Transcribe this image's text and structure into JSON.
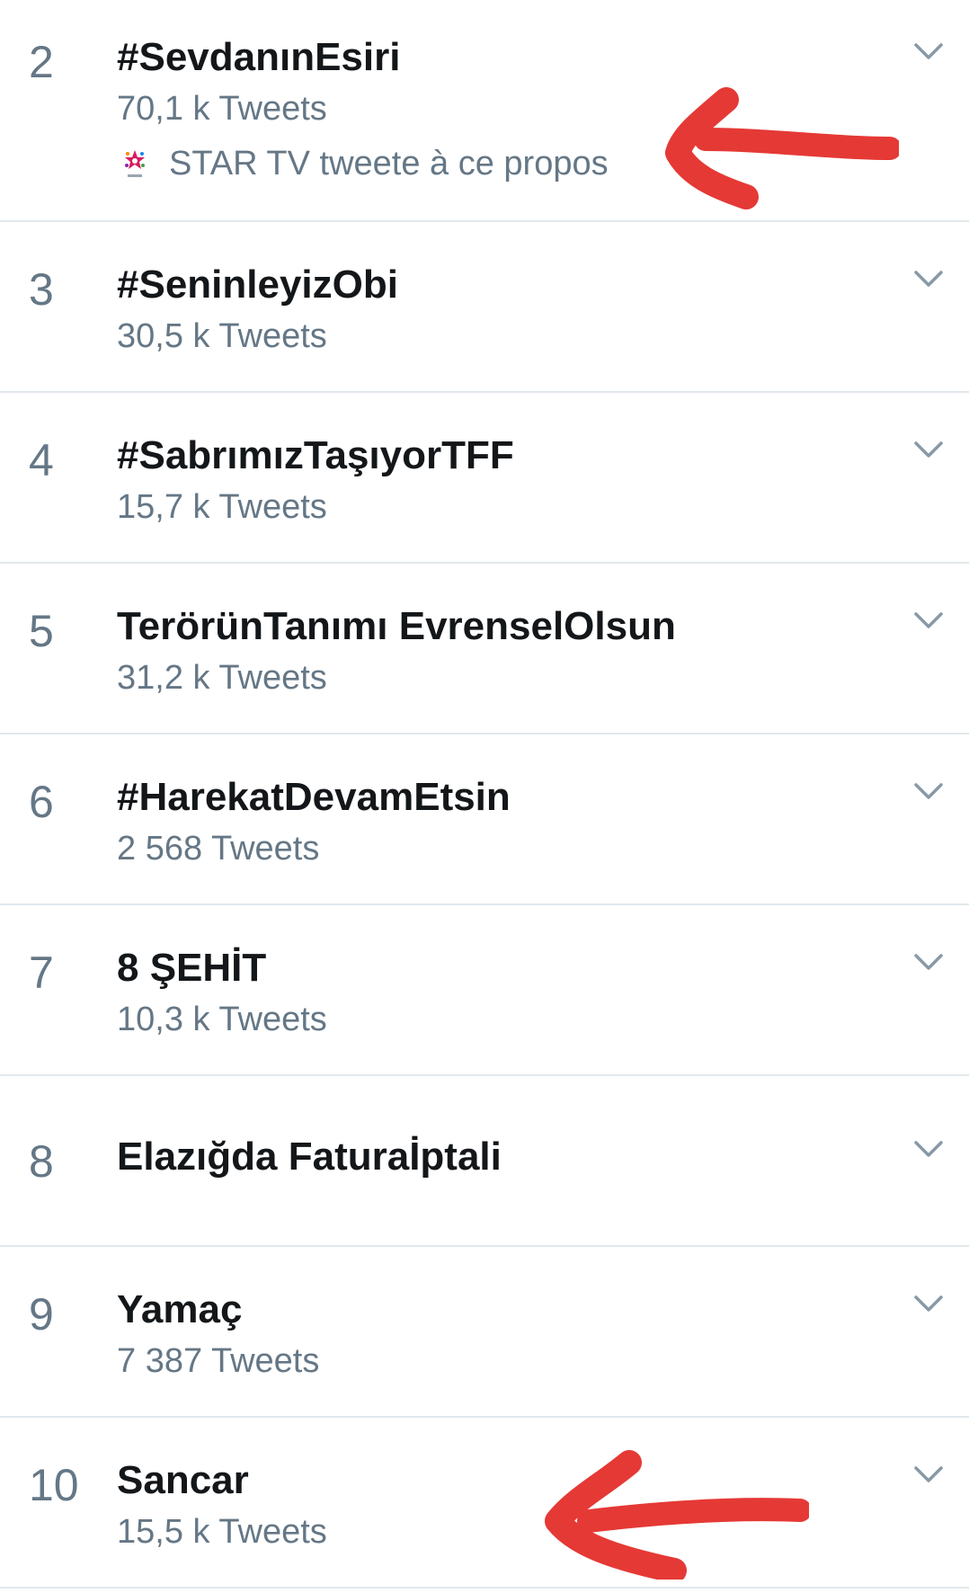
{
  "trends": [
    {
      "rank": "2",
      "topic": "#SevdanınEsiri",
      "count": "70,1 k Tweets",
      "context": "STAR TV tweete à ce propos",
      "context_icon": "star-tv-logo"
    },
    {
      "rank": "3",
      "topic": "#SeninleyizObi",
      "count": "30,5 k Tweets"
    },
    {
      "rank": "4",
      "topic": "#SabrımızTaşıyorTFF",
      "count": "15,7 k Tweets"
    },
    {
      "rank": "5",
      "topic": "TerörünTanımı EvrenselOlsun",
      "count": "31,2 k Tweets"
    },
    {
      "rank": "6",
      "topic": "#HarekatDevamEtsin",
      "count": "2 568 Tweets"
    },
    {
      "rank": "7",
      "topic": "8 ŞEHİT",
      "count": "10,3 k Tweets"
    },
    {
      "rank": "8",
      "topic": "Elazığda Faturaİptali",
      "count": ""
    },
    {
      "rank": "9",
      "topic": "Yamaç",
      "count": "7 387 Tweets"
    },
    {
      "rank": "10",
      "topic": "Sancar",
      "count": "15,5 k Tweets"
    }
  ],
  "icons": {
    "row_menu": "chevron-down-icon",
    "annotation": "red-hand-drawn-arrow"
  },
  "colors": {
    "topic_text": "#14171a",
    "secondary_text": "#657786",
    "divider": "#e1e8ed",
    "annotation_arrow": "#e53935",
    "background": "#ffffff"
  }
}
